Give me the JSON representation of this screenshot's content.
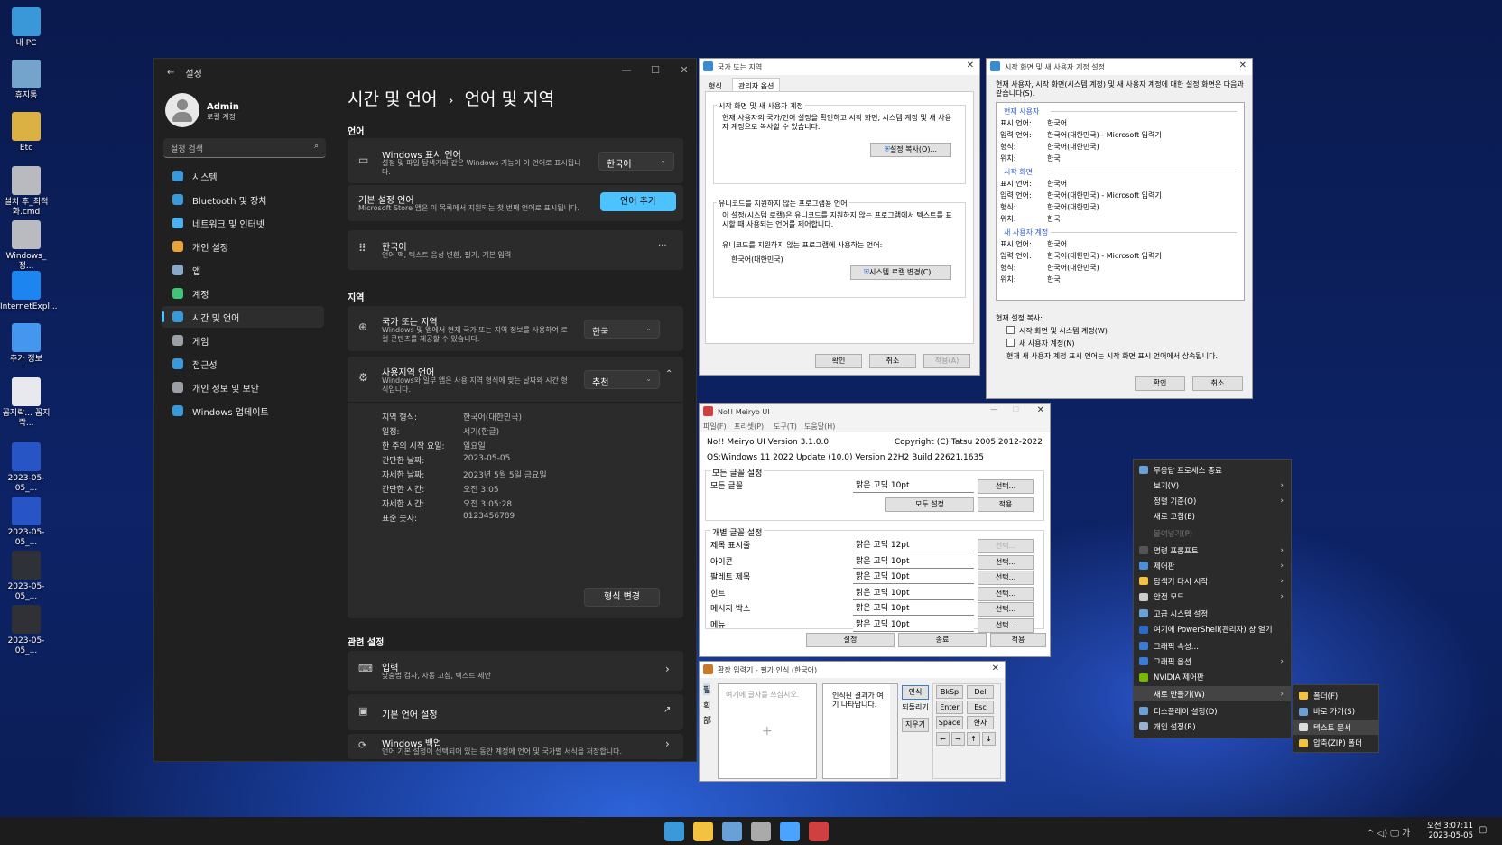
{
  "desktop": {
    "icons": [
      {
        "label": "내 PC",
        "icon": "monitor-icon",
        "color": "#3fa6e8"
      },
      {
        "label": "휴지통",
        "icon": "recycle-bin-icon",
        "color": "#7fb4d8"
      },
      {
        "label": "Etc",
        "icon": "folder-icon",
        "color": "#f3c241"
      },
      {
        "label": "설치 후_최적화.cmd",
        "icon": "gear-script-icon",
        "color": "#cccccc"
      },
      {
        "label": "Windows_정...",
        "icon": "gear-script-icon",
        "color": "#cccccc"
      },
      {
        "label": "InternetExpl...",
        "icon": "internet-explorer-icon",
        "color": "#1e90ff"
      },
      {
        "label": "추가 정보",
        "icon": "globe-icon",
        "color": "#4aa3ff"
      },
      {
        "label": "꼼지락... 꼼지락...",
        "icon": "document-icon",
        "color": "#ffffff"
      },
      {
        "label": "2023-05-05_...",
        "icon": "image-icon",
        "color": "#2a5bd0"
      },
      {
        "label": "2023-05-05_...",
        "icon": "image-icon",
        "color": "#2a5bd0"
      },
      {
        "label": "2023-05-05_...",
        "icon": "image-icon",
        "color": "#333333"
      },
      {
        "label": "2023-05-05_...",
        "icon": "image-icon",
        "color": "#333333"
      }
    ]
  },
  "settings": {
    "window_title": "설정",
    "user_name": "Admin",
    "user_sub": "로컬 계정",
    "search_placeholder": "설정 검색",
    "nav": [
      {
        "label": "시스템",
        "icon": "system-icon",
        "color": "#3a9ad9"
      },
      {
        "label": "Bluetooth 및 장치",
        "icon": "bluetooth-icon",
        "color": "#3a9ad9"
      },
      {
        "label": "네트워크 및 인터넷",
        "icon": "wifi-icon",
        "color": "#4ab0f0"
      },
      {
        "label": "개인 설정",
        "icon": "brush-icon",
        "color": "#e8a33a"
      },
      {
        "label": "앱",
        "icon": "apps-icon",
        "color": "#8aa8c8"
      },
      {
        "label": "계정",
        "icon": "account-icon",
        "color": "#3fc47a"
      },
      {
        "label": "시간 및 언어",
        "icon": "time-language-icon",
        "color": "#3a9ad9"
      },
      {
        "label": "게임",
        "icon": "gamepad-icon",
        "color": "#9aa0a6"
      },
      {
        "label": "접근성",
        "icon": "accessibility-icon",
        "color": "#3a9ad9"
      },
      {
        "label": "개인 정보 및 보안",
        "icon": "shield-icon",
        "color": "#9aa0a6"
      },
      {
        "label": "Windows 업데이트",
        "icon": "update-icon",
        "color": "#3a9ad9"
      }
    ],
    "breadcrumb_parent": "시간 및 언어",
    "breadcrumb_sep": "›",
    "breadcrumb_current": "언어 및 지역",
    "section_language": "언어",
    "display_lang_title": "Windows 표시 언어",
    "display_lang_desc": "설정 및 파일 탐색기와 같은 Windows 기능이 이 언어로 표시됩니다.",
    "display_lang_value": "한국어",
    "pref_lang_title": "기본 설정 언어",
    "pref_lang_desc": "Microsoft Store 앱은 이 목록에서 지원되는 첫 번째 언어로 표시됩니다.",
    "add_lang_button": "언어 추가",
    "korean_title": "한국어",
    "korean_desc": "언어 팩, 텍스트 음성 변환, 필기, 기본 입력",
    "more": "···",
    "section_region": "지역",
    "country_title": "국가 또는 지역",
    "country_desc": "Windows 및 앱에서 현재 국가 또는 지역 정보를 사용하여 로컬 콘텐츠를 제공할 수 있습니다.",
    "country_value": "한국",
    "regional_title": "사용지역 언어",
    "regional_desc": "Windows와 일부 앱은 사용 지역 형식에 맞는 날짜와 시간 형식입니다.",
    "regional_value": "추천",
    "format_rows": [
      {
        "k": "지역 형식:",
        "v": "한국어(대한민국)"
      },
      {
        "k": "일정:",
        "v": "서기(한글)"
      },
      {
        "k": "한 주의 시작 요일:",
        "v": "일요일"
      },
      {
        "k": "간단한 날짜:",
        "v": "2023-05-05"
      },
      {
        "k": "자세한 날짜:",
        "v": "2023년 5월 5일 금요일"
      },
      {
        "k": "간단한 시간:",
        "v": "오전 3:05"
      },
      {
        "k": "자세한 시간:",
        "v": "오전 3:05:28"
      },
      {
        "k": "표준 숫자:",
        "v": "0123456789"
      }
    ],
    "change_format_button": "형식 변경",
    "section_related": "관련 설정",
    "input_title": "입력",
    "input_desc": "맞춤법 검사, 자동 고침, 텍스트 제안",
    "admin_lang_title": "기본 언어 설정",
    "backup_title": "Windows 백업",
    "backup_desc": "언어 기본 설정이 선택되어 있는 동안 계정에 언어 및 국가별 서식을 저장합니다."
  },
  "region_dialog": {
    "title": "국가 또는 지역",
    "tabs": [
      "형식",
      "관리자 옵션"
    ],
    "group1_title": "시작 화면 및 새 사용자 계정",
    "group1_text": "현재 사용자의 국가/언어 설정을 확인하고 시작 화면, 시스템 계정 및 새 사용자 계정으로 복사할 수 있습니다.",
    "copy_button": "설정 복사(O)...",
    "group2_title": "유니코드를 지원하지 않는 프로그램용 언어",
    "group2_text": "이 설정(시스템 로캘)은 유니코드를 지원하지 않는 프로그램에서 텍스트를 표시할 때 사용되는 언어를 제어합니다.",
    "current_label": "유니코드를 지원하지 않는 프로그램에 사용하는 언어:",
    "current_value": "한국어(대한민국)",
    "change_locale_button": "시스템 로캘 변경(C)...",
    "ok": "확인",
    "cancel": "취소",
    "apply": "적용(A)"
  },
  "copy_dialog": {
    "title": "시작 화면 및 새 사용자 계정 설정",
    "intro": "현재 사용자, 시작 화면(시스템 계정) 및 새 사용자 계정에 대한 설정 화면은 다음과 같습니다(S).",
    "groups": [
      {
        "title": "현재 사용자",
        "rows": [
          {
            "k": "표시 언어:",
            "v": "한국어"
          },
          {
            "k": "입력 언어:",
            "v": "한국어(대한민국) - Microsoft 입력기"
          },
          {
            "k": "형식:",
            "v": "한국어(대한민국)"
          },
          {
            "k": "위치:",
            "v": "한국"
          }
        ]
      },
      {
        "title": "시작 화면",
        "rows": [
          {
            "k": "표시 언어:",
            "v": "한국어"
          },
          {
            "k": "입력 언어:",
            "v": "한국어(대한민국) - Microsoft 입력기"
          },
          {
            "k": "형식:",
            "v": "한국어(대한민국)"
          },
          {
            "k": "위치:",
            "v": "한국"
          }
        ]
      },
      {
        "title": "새 사용자 계정",
        "rows": [
          {
            "k": "표시 언어:",
            "v": "한국어"
          },
          {
            "k": "입력 언어:",
            "v": "한국어(대한민국) - Microsoft 입력기"
          },
          {
            "k": "형식:",
            "v": "한국어(대한민국)"
          },
          {
            "k": "위치:",
            "v": "한국"
          }
        ]
      }
    ],
    "copy_label": "현재 설정 복사:",
    "check1": "시작 화면 및 시스템 계정(W)",
    "check2": "새 사용자 계정(N)",
    "note": "현재 새 사용자 계정 표시 언어는 시작 화면 표시 언어에서 상속됩니다.",
    "ok": "확인",
    "cancel": "취소"
  },
  "meiryo": {
    "title": "No!! Meiryo UI",
    "menu": [
      "파일(F)",
      "프리셋(P)",
      "도구(T)",
      "도움말(H)"
    ],
    "version": "No!! Meiryo UI Version 3.1.0.0",
    "copyright": "Copyright (C) Tatsu 2005,2012-2022",
    "os": "OS:Windows 11 2022 Update (10.0) Version 22H2 Build 22621.1635",
    "all_group": "모든 글꼴 설정",
    "all_label": "모든 글꼴",
    "all_font": "맑은 고딕  10pt",
    "select": "선택...",
    "set_all": "모두 설정",
    "apply": "적용",
    "indiv_group": "개별 글꼴 설정",
    "rows": [
      {
        "label": "제목 표시줄",
        "font": "맑은 고딕  12pt",
        "disabled": true
      },
      {
        "label": "아이콘",
        "font": "맑은 고딕  10pt",
        "disabled": false
      },
      {
        "label": "팔레트 제목",
        "font": "맑은 고딕  10pt",
        "disabled": false
      },
      {
        "label": "힌트",
        "font": "맑은 고딕  10pt",
        "disabled": false
      },
      {
        "label": "메시지 박스",
        "font": "맑은 고딕  10pt",
        "disabled": false
      },
      {
        "label": "메뉴",
        "font": "맑은 고딕  10pt",
        "disabled": false
      }
    ],
    "settings_btn": "설정",
    "exit_btn": "종료",
    "apply_btn": "적용"
  },
  "ime": {
    "title": "확장 입력기 - 필기 인식 (한국어)",
    "side": [
      "필",
      "획",
      "部"
    ],
    "placeholder": "여기에 글자를 쓰십시오.",
    "result": "인식된 결과가 여기 나타납니다.",
    "recognize": "인식",
    "undo": "되돌리기",
    "clear": "지우기",
    "keys": [
      "BkSp",
      "Del",
      "Enter",
      "Esc",
      "Space",
      "한자"
    ],
    "arrows": [
      "←",
      "→",
      "↑",
      "↓"
    ]
  },
  "context_menu": {
    "items": [
      {
        "label": "무응답 프로세스 종료",
        "icon": "process-icon",
        "color": "#6aa0d8",
        "arrow": false,
        "disabled": false
      },
      {
        "label": "보기(V)",
        "icon": "",
        "color": "",
        "arrow": true,
        "disabled": false
      },
      {
        "label": "정렬 기준(O)",
        "icon": "",
        "color": "",
        "arrow": true,
        "disabled": false
      },
      {
        "label": "새로 고침(E)",
        "icon": "",
        "color": "",
        "arrow": false,
        "disabled": false
      },
      {
        "label": "붙여넣기(P)",
        "icon": "",
        "color": "",
        "arrow": false,
        "disabled": true
      },
      {
        "label": "명령 프롬프트",
        "icon": "cmd-icon",
        "color": "#555555",
        "arrow": true,
        "disabled": false
      },
      {
        "label": "제어판",
        "icon": "control-panel-icon",
        "color": "#4a90d9",
        "arrow": true,
        "disabled": false
      },
      {
        "label": "탐색기 다시 시작",
        "icon": "folder-icon",
        "color": "#f3c241",
        "arrow": true,
        "disabled": false
      },
      {
        "label": "안전 모드",
        "icon": "gear-icon",
        "color": "#cccccc",
        "arrow": true,
        "disabled": false
      },
      {
        "label": "고급 시스템 설정",
        "icon": "system-icon",
        "color": "#6aa0d8",
        "arrow": false,
        "disabled": false
      },
      {
        "label": "여기에 PowerShell(관리자) 창 열기",
        "icon": "powershell-icon",
        "color": "#2a6acb",
        "arrow": false,
        "disabled": false
      },
      {
        "label": "그래픽 속성...",
        "icon": "graphics-icon",
        "color": "#3a7bd5",
        "arrow": false,
        "disabled": false
      },
      {
        "label": "그래픽 옵션",
        "icon": "graphics-icon",
        "color": "#3a7bd5",
        "arrow": true,
        "disabled": false
      },
      {
        "label": "NVIDIA 제어판",
        "icon": "nvidia-icon",
        "color": "#76b900",
        "arrow": false,
        "disabled": false
      },
      {
        "label": "새로 만들기(W)",
        "icon": "",
        "color": "",
        "arrow": true,
        "disabled": false
      },
      {
        "label": "디스플레이 설정(D)",
        "icon": "display-icon",
        "color": "#6aa0d8",
        "arrow": false,
        "disabled": false
      },
      {
        "label": "개인 설정(R)",
        "icon": "brush-icon",
        "color": "#9ab0d0",
        "arrow": false,
        "disabled": false
      }
    ],
    "submenu": [
      {
        "label": "폴더(F)",
        "icon": "folder-icon",
        "color": "#f3c241"
      },
      {
        "label": "바로 가기(S)",
        "icon": "shortcut-icon",
        "color": "#6aa0d8"
      },
      {
        "label": "텍스트 문서",
        "icon": "text-document-icon",
        "color": "#dddddd"
      },
      {
        "label": "압축(ZIP) 폴더",
        "icon": "zip-folder-icon",
        "color": "#f3c241"
      }
    ]
  },
  "taskbar": {
    "apps": [
      {
        "name": "start-icon",
        "color": "#3a9ad9"
      },
      {
        "name": "file-explorer-icon",
        "color": "#f3c241"
      },
      {
        "name": "screenshot-app-icon",
        "color": "#6aa0d8"
      },
      {
        "name": "settings-gear-icon",
        "color": "#aaaaaa"
      },
      {
        "name": "globe-icon",
        "color": "#4aa3ff"
      },
      {
        "name": "meiryo-app-icon",
        "color": "#d04040"
      }
    ],
    "tray": "^ ◁) 🖵 가",
    "time": "오전 3:07:11",
    "date": "2023-05-05"
  }
}
